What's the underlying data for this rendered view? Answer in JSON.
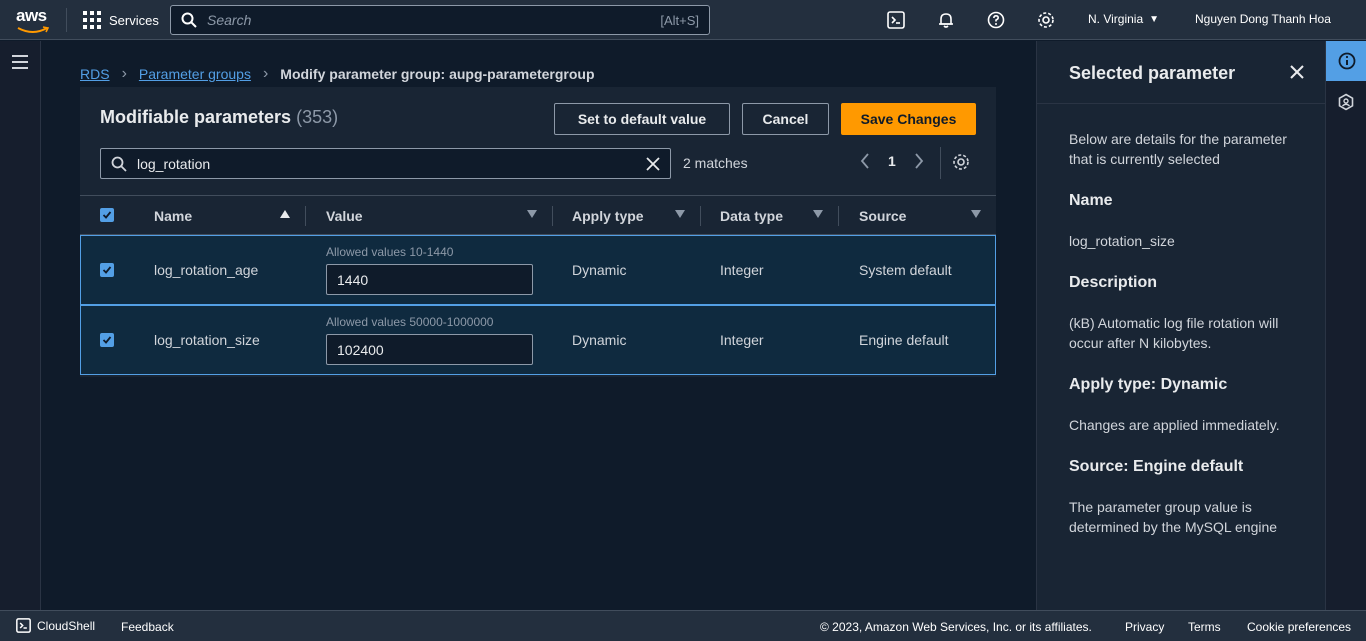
{
  "topnav": {
    "logo_text": "aws",
    "services_label": "Services",
    "search_placeholder": "Search",
    "search_shortcut": "[Alt+S]",
    "region": "N. Virginia",
    "user": "Nguyen Dong Thanh Hoa"
  },
  "breadcrumb": {
    "items": [
      "RDS",
      "Parameter groups"
    ],
    "current": "Modify parameter group: aupg-parametergroup"
  },
  "container": {
    "title": "Modifiable parameters",
    "count": "(353)",
    "buttons": {
      "set_default": "Set to default value",
      "cancel": "Cancel",
      "save": "Save Changes"
    },
    "filter_value": "log_rotation",
    "matches": "2 matches",
    "page": "1"
  },
  "table": {
    "columns": [
      "Name",
      "Value",
      "Apply type",
      "Data type",
      "Source"
    ],
    "rows": [
      {
        "name": "log_rotation_age",
        "allowed": "Allowed values 10-1440",
        "value": "1440",
        "apply_type": "Dynamic",
        "data_type": "Integer",
        "source": "System default",
        "checked": true
      },
      {
        "name": "log_rotation_size",
        "allowed": "Allowed values 50000-1000000",
        "value": "102400",
        "apply_type": "Dynamic",
        "data_type": "Integer",
        "source": "Engine default",
        "checked": true
      }
    ]
  },
  "side_panel": {
    "title": "Selected parameter",
    "intro": "Below are details for the parameter that is currently selected",
    "name_heading": "Name",
    "name_value": "log_rotation_size",
    "description_heading": "Description",
    "description_value": "(kB) Automatic log file rotation will occur after N kilobytes.",
    "apply_heading": "Apply type: Dynamic",
    "apply_value": "Changes are applied immediately.",
    "source_heading": "Source: Engine default",
    "source_value": "The parameter group value is determined by the MySQL engine"
  },
  "footer": {
    "cloudshell": "CloudShell",
    "feedback": "Feedback",
    "copyright": "© 2023, Amazon Web Services, Inc. or its affiliates.",
    "privacy": "Privacy",
    "terms": "Terms",
    "cookies": "Cookie preferences"
  },
  "colors": {
    "accent": "#539fe5",
    "primary_button": "#ff9900",
    "nav_bg": "#232f3e",
    "page_bg": "#0f1b2a"
  },
  "icons": [
    "grid-icon",
    "search-icon",
    "cloudshell-icon",
    "bell-icon",
    "help-icon",
    "gear-icon",
    "menu-icon",
    "close-icon",
    "info-icon",
    "hexagon-icon",
    "chevron-left-icon",
    "chevron-right-icon",
    "caret-down-icon",
    "sort-up-icon",
    "checkbox-icon"
  ]
}
